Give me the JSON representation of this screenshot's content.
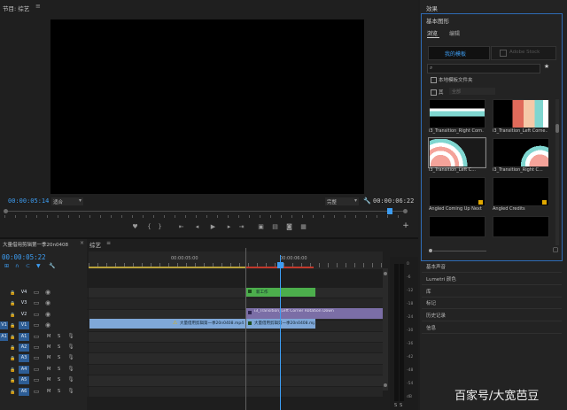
{
  "program_monitor": {
    "title": "节目: 综艺",
    "current_time": "00:00:05:14",
    "fit_value": "适合",
    "quality_value": "完整",
    "duration": "00:00:06:22"
  },
  "transport": {
    "buttons": [
      {
        "name": "marker-icon",
        "glyph": "♥"
      },
      {
        "name": "mark-in-icon",
        "glyph": "{"
      },
      {
        "name": "mark-out-icon",
        "glyph": "}"
      },
      {
        "name": "go-to-in-icon",
        "glyph": "⇤"
      },
      {
        "name": "step-back-icon",
        "glyph": "◂"
      },
      {
        "name": "play-icon",
        "glyph": "▶"
      },
      {
        "name": "step-forward-icon",
        "glyph": "▸"
      },
      {
        "name": "go-to-out-icon",
        "glyph": "⇥"
      },
      {
        "name": "lift-icon",
        "glyph": "▣"
      },
      {
        "name": "extract-icon",
        "glyph": "▤"
      },
      {
        "name": "export-frame-icon",
        "glyph": "◙"
      },
      {
        "name": "compare-icon",
        "glyph": "▦"
      }
    ],
    "add_glyph": "+"
  },
  "project_panel": {
    "title": "大量借用剪辑第一季20n0408"
  },
  "timeline": {
    "tab_label": "综艺",
    "timecode": "00:00:05:22",
    "ruler_labels": [
      "00:00:05:00",
      "00:00:06:00"
    ],
    "video_tracks": [
      "V4",
      "V3",
      "V2",
      "V1"
    ],
    "audio_tracks": [
      "A1",
      "A2",
      "A3",
      "A4",
      "A5",
      "A6"
    ],
    "audio_track_letters": [
      "M",
      "S"
    ],
    "source_labels": {
      "v1": "V1",
      "a1": "A1"
    },
    "clips": {
      "text_clip": "新工作",
      "transition_clip": "i3_Transition_Left Corner Rotation Down",
      "video_clip_a": "大量借用剪辑第一季20n0408.mp4",
      "video_clip_b": "大量借用剪辑第一季20n0408.mp4"
    },
    "audio_meter_labels": [
      "0",
      "-6",
      "-12",
      "-18",
      "-24",
      "-30",
      "-36",
      "-42",
      "-48",
      "-54",
      "dB"
    ],
    "sm_labels": [
      "S",
      "S"
    ]
  },
  "effects_panel": {
    "title": "效果",
    "essential_graphics": {
      "title": "基本图形",
      "tabs": [
        "浏览",
        "编辑"
      ],
      "my_templates_btn": "我的模板",
      "adobe_stock_btn": "Adobe Stock",
      "checkbox_local": "本地模板文件夹",
      "checkbox_other": "其",
      "dropdown_value": "全部",
      "templates": [
        "i3_Transition_Right Corn...",
        "i3_Transition_Left Corne...",
        "i3_Transition_Left C...",
        "i3_Transition_Right C...",
        "Angled Coming Up Next",
        "Angled Credits",
        "",
        ""
      ]
    },
    "side_items": [
      "基本声音",
      "Lumetri 颜色",
      "库",
      "标记",
      "历史记录",
      "信息"
    ]
  },
  "watermark": {
    "text": "百家号/大宽芭豆"
  },
  "colors": {
    "accent": "#3d9df2",
    "video_clip": "#7fa8d8",
    "text_clip": "#4cae4c",
    "transition_clip": "#7b6ea6",
    "playhead": "#3d9df2"
  }
}
